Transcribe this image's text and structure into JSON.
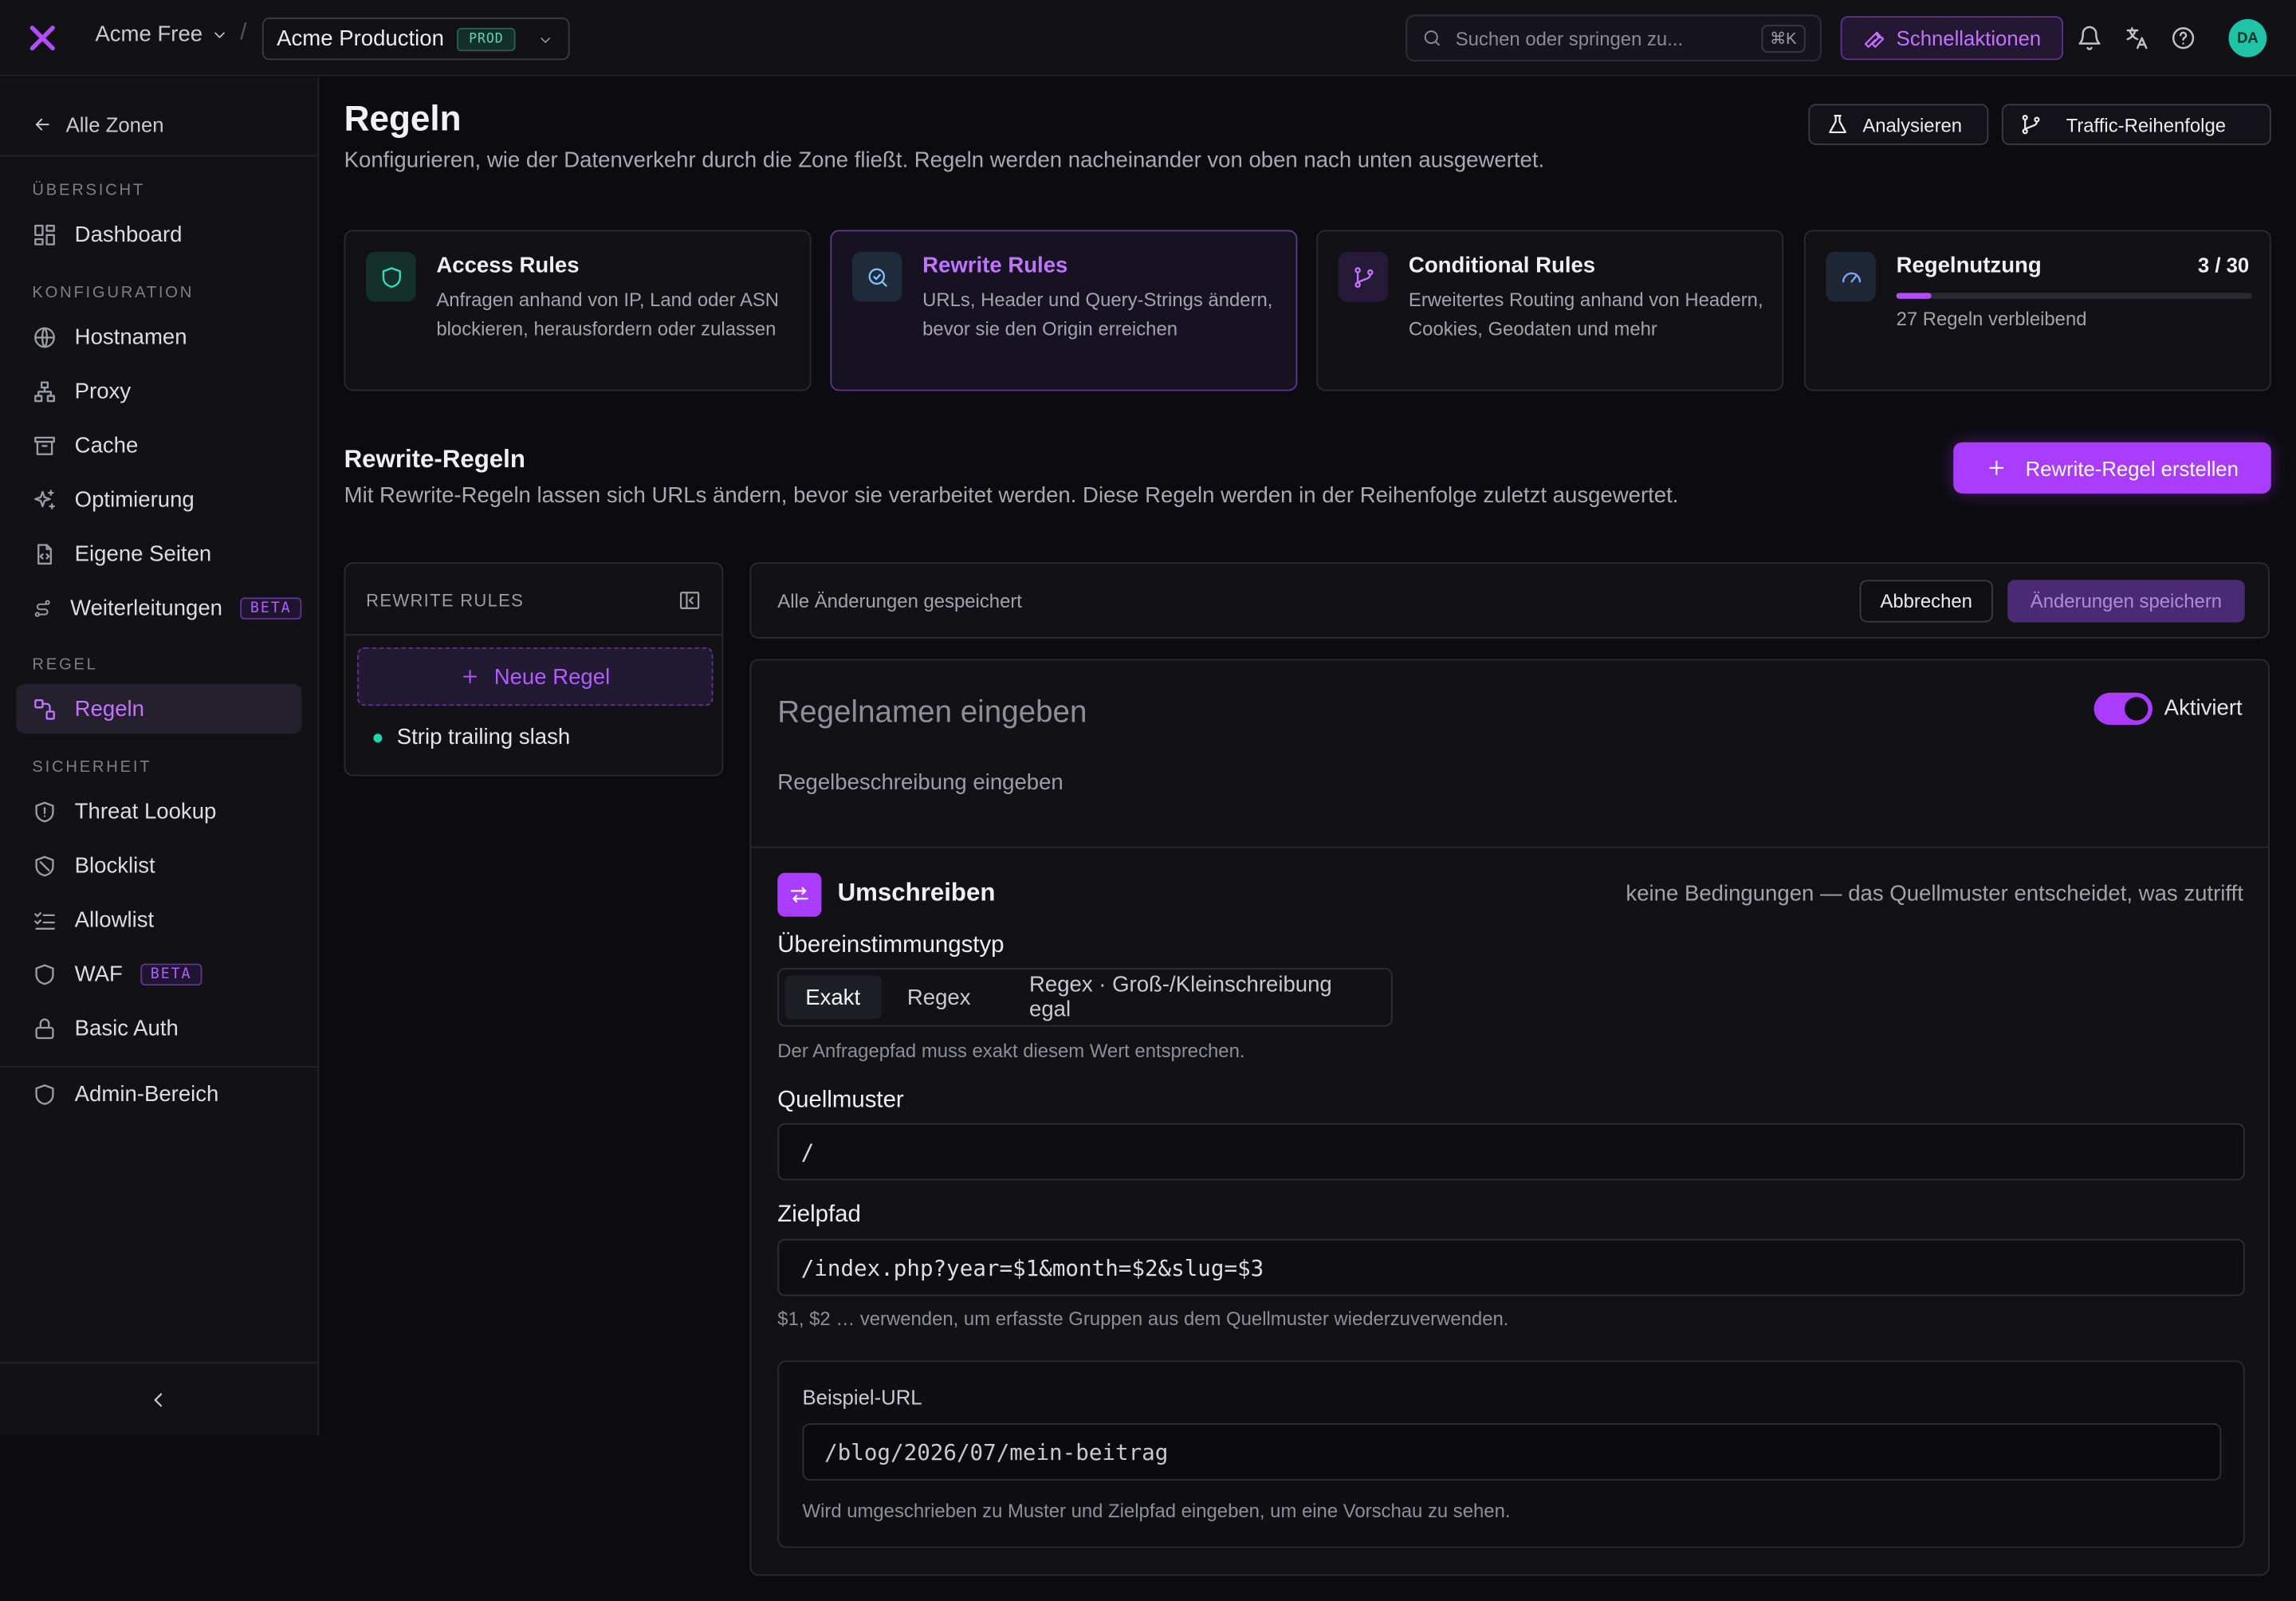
{
  "topbar": {
    "org": "Acme Free",
    "separator": "/",
    "zone": "Acme Production",
    "zone_badge": "PROD",
    "search_placeholder": "Suchen oder springen zu...",
    "search_shortcut": "⌘K",
    "quick_actions": "Schnellaktionen",
    "avatar_initials": "DA"
  },
  "sidebar": {
    "back": "Alle Zonen",
    "sections": {
      "overview": "ÜBERSICHT",
      "config": "KONFIGURATION",
      "rule": "REGEL",
      "security": "SICHERHEIT"
    },
    "items": {
      "dashboard": "Dashboard",
      "hostnames": "Hostnamen",
      "proxy": "Proxy",
      "cache": "Cache",
      "optimization": "Optimierung",
      "custom_pages": "Eigene Seiten",
      "redirects": "Weiterleitungen",
      "redirects_badge": "BETA",
      "rules": "Regeln",
      "threat_lookup": "Threat Lookup",
      "blocklist": "Blocklist",
      "allowlist": "Allowlist",
      "waf": "WAF",
      "waf_badge": "BETA",
      "basic_auth": "Basic Auth",
      "admin": "Admin-Bereich"
    }
  },
  "header": {
    "title": "Regeln",
    "subtitle": "Konfigurieren, wie der Datenverkehr durch die Zone fließt. Regeln werden nacheinander von oben nach unten ausgewertet.",
    "analyze": "Analysieren",
    "traffic_order": "Traffic-Reihenfolge"
  },
  "cards": {
    "access": {
      "title": "Access Rules",
      "desc": "Anfragen anhand von IP, Land oder ASN blockieren, herausfordern oder zulassen"
    },
    "rewrite": {
      "title": "Rewrite Rules",
      "desc": "URLs, Header und Query-Strings ändern, bevor sie den Origin erreichen"
    },
    "conditional": {
      "title": "Conditional Rules",
      "desc": "Erweitertes Routing anhand von Headern, Cookies, Geodaten und mehr"
    },
    "usage": {
      "title": "Regelnutzung",
      "count": "3 / 30",
      "used": 3,
      "limit": 30,
      "remaining": "27 Regeln verbleibend"
    }
  },
  "section": {
    "title": "Rewrite-Regeln",
    "subtitle": "Mit Rewrite-Regeln lassen sich URLs ändern, bevor sie verarbeitet werden. Diese Regeln werden in der Reihenfolge zuletzt ausgewertet.",
    "create": "Rewrite-Regel erstellen"
  },
  "rules_list": {
    "header": "REWRITE RULES",
    "new_rule": "Neue Regel",
    "items": [
      "Strip trailing slash"
    ]
  },
  "save_bar": {
    "status": "Alle Änderungen gespeichert",
    "cancel": "Abbrechen",
    "save": "Änderungen speichern"
  },
  "editor": {
    "name_placeholder": "Regelnamen eingeben",
    "enabled_label": "Aktiviert",
    "desc_placeholder": "Regelbeschreibung eingeben",
    "action_title": "Umschreiben",
    "action_note": "keine Bedingungen — das Quellmuster entscheidet, was zutrifft",
    "match_type_label": "Übereinstimmungstyp",
    "match_options": [
      "Exakt",
      "Regex",
      "Regex · Groß-/Kleinschreibung egal"
    ],
    "match_help": "Der Anfragepfad muss exakt diesem Wert entsprechen.",
    "source_label": "Quellmuster",
    "source_value": "/",
    "target_label": "Zielpfad",
    "target_value": "/index.php?year=$1&month=$2&slug=$3",
    "target_help": "$1, $2 … verwenden, um erfasste Gruppen aus dem Quellmuster wiederzuverwenden.",
    "example_label": "Beispiel-URL",
    "example_value": "/blog/2026/07/mein-beitrag",
    "example_result": "Wird umgeschrieben zu  Muster und Zielpfad eingeben, um eine Vorschau zu sehen."
  },
  "colors": {
    "accent": "#a93cff",
    "accent_text": "#c074ff",
    "teal": "#1fc3a6",
    "background": "#0c0c10",
    "panel": "#111116"
  }
}
